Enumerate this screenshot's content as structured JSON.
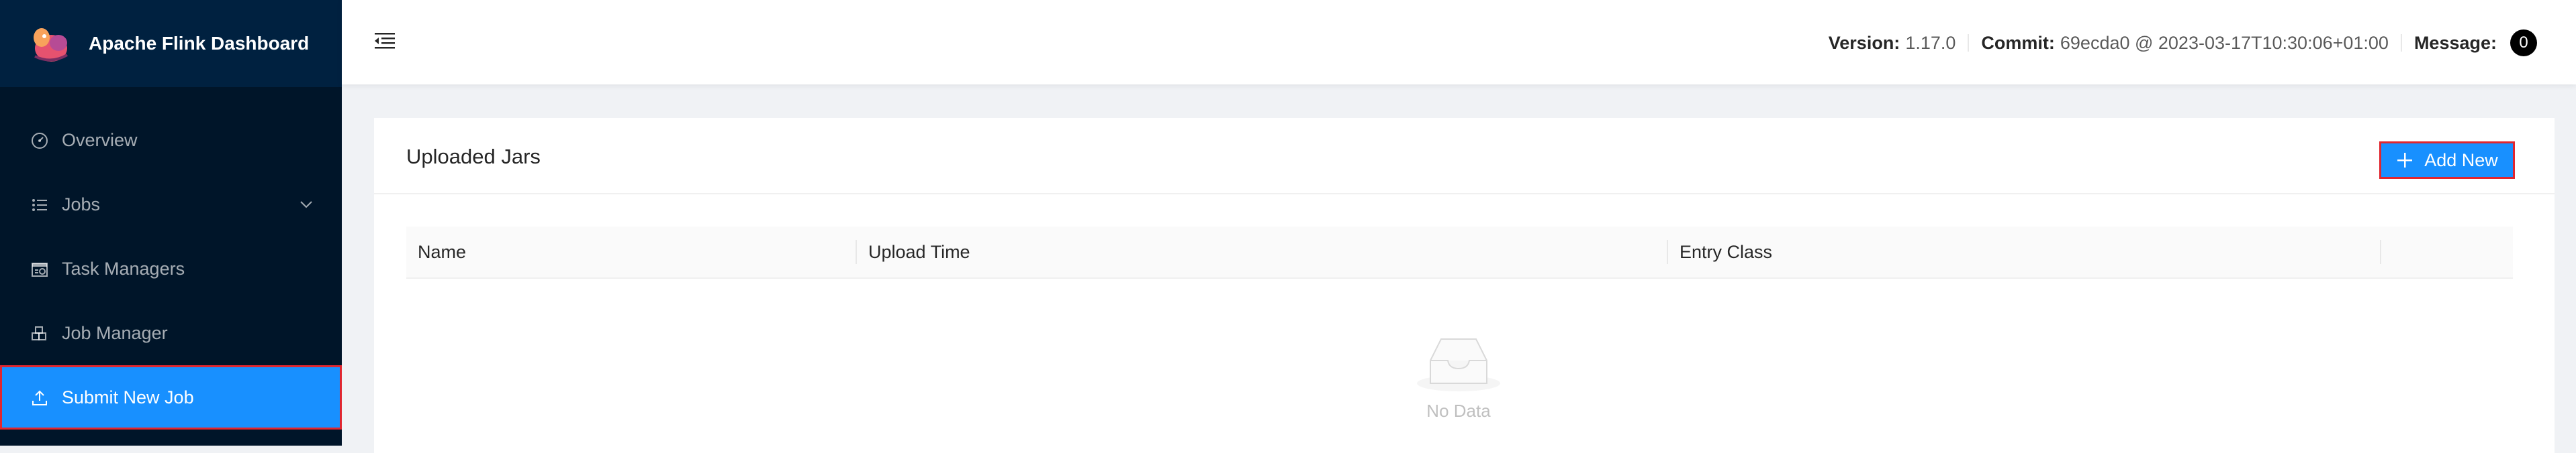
{
  "sidebar": {
    "title": "Apache Flink Dashboard",
    "items": [
      {
        "label": "Overview",
        "icon": "dashboard-icon"
      },
      {
        "label": "Jobs",
        "icon": "unordered-list-icon",
        "has_submenu": true
      },
      {
        "label": "Task Managers",
        "icon": "schedule-icon"
      },
      {
        "label": "Job Manager",
        "icon": "build-icon"
      },
      {
        "label": "Submit New Job",
        "icon": "upload-icon",
        "selected": true
      }
    ]
  },
  "header": {
    "version_label": "Version:",
    "version_value": "1.17.0",
    "commit_label": "Commit:",
    "commit_value": "69ecda0 @ 2023-03-17T10:30:06+01:00",
    "message_label": "Message:",
    "message_count": "0"
  },
  "card": {
    "title": "Uploaded Jars",
    "add_button_label": "Add New"
  },
  "table": {
    "columns": [
      "Name",
      "Upload Time",
      "Entry Class",
      ""
    ],
    "empty_text": "No Data"
  },
  "colors": {
    "sidebar_bg": "#001529",
    "selected_bg": "#1890ff",
    "highlight_border": "#e0262f"
  }
}
